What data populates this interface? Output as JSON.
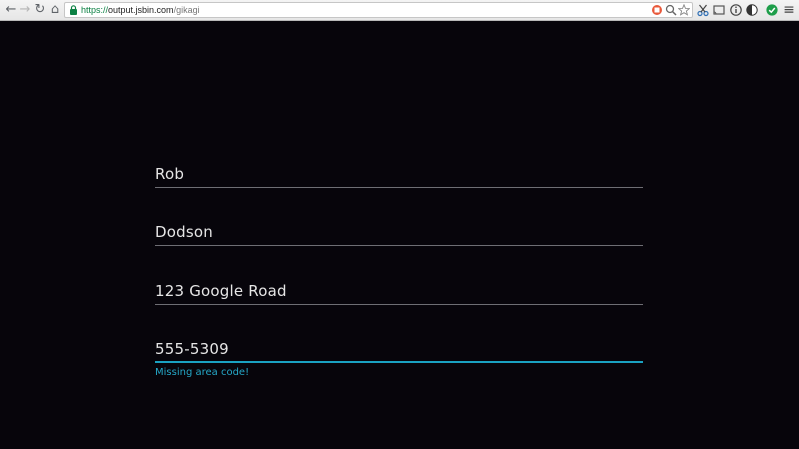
{
  "browser": {
    "back_glyph": "←",
    "forward_glyph": "→",
    "reload_glyph": "↻",
    "home_glyph": "⌂",
    "url_scheme": "https://",
    "url_host": "output.jsbin.com",
    "url_path": "/gikagi",
    "menu_glyph": "≡",
    "icons": [
      "back-icon",
      "forward-icon",
      "reload-icon",
      "home-icon",
      "lock-icon",
      "extension-icon",
      "zoom-icon",
      "bookmark-star-icon",
      "scissors-icon",
      "cast-icon",
      "info-icon",
      "contrast-icon",
      "shield-check-icon",
      "menu-icon"
    ]
  },
  "form": {
    "first_name": "Rob",
    "last_name": "Dodson",
    "address": "123 Google Road",
    "phone": "555-5309",
    "phone_error": "Missing area code!"
  },
  "colors": {
    "background": "#07050b",
    "text": "#e6e6e6",
    "underline": "#6e6e74",
    "accent": "#1aa2c2",
    "url_scheme": "#0b8043"
  }
}
